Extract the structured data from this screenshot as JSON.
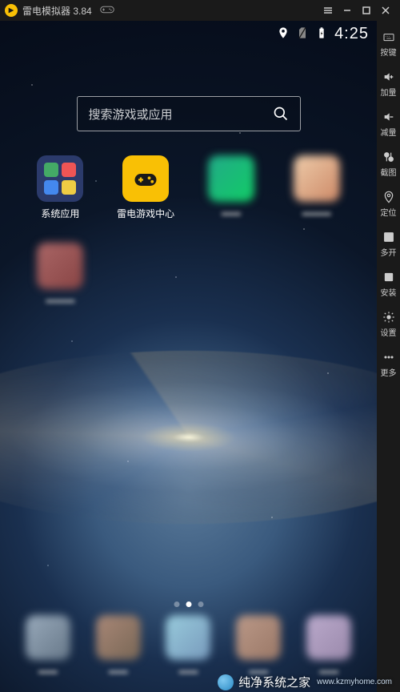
{
  "titlebar": {
    "title": "雷电模拟器 3.84"
  },
  "statusbar": {
    "time": "4:25"
  },
  "search": {
    "placeholder": "搜索游戏或应用"
  },
  "apps": [
    {
      "id": "system",
      "label": "系统应用"
    },
    {
      "id": "gamecenter",
      "label": "雷电游戏中心"
    },
    {
      "id": "app3",
      "label": "",
      "blurred": true
    },
    {
      "id": "app4",
      "label": "",
      "blurred": true
    },
    {
      "id": "app5",
      "label": "",
      "blurred": true
    }
  ],
  "sidebar": {
    "keys": "按键",
    "vol_up": "加量",
    "vol_down": "减量",
    "screenshot": "截图",
    "location": "定位",
    "multi": "多开",
    "install": "安装",
    "settings": "设置",
    "more": "更多"
  },
  "watermark": {
    "brand": "纯净系统之家",
    "url": "www.kzmyhome.com"
  }
}
